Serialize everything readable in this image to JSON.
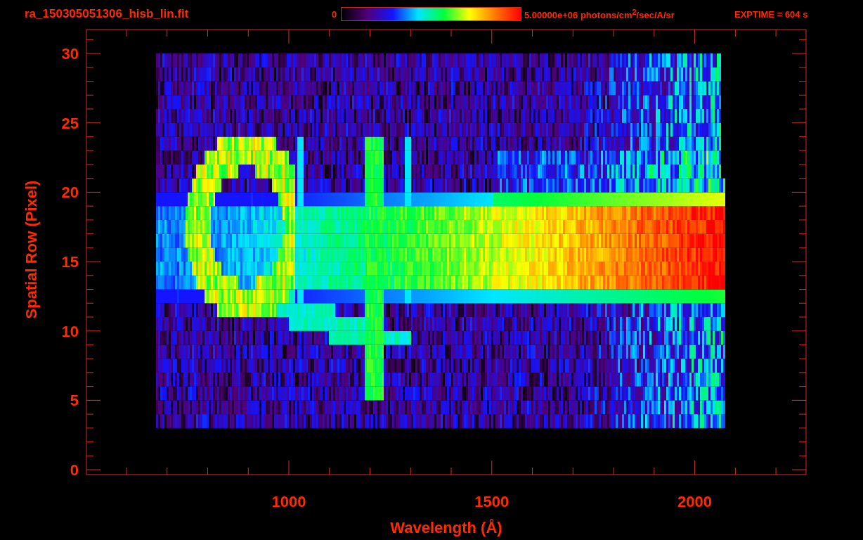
{
  "title": "ra_150305051306_hisb_lin.fit",
  "colorbar": {
    "min_label": "0",
    "max_label": "5.00000e+06 photons/cm$^{2}$/sec/A/sr"
  },
  "exposure": "EXPTIME = 604 s",
  "plot": {
    "ylabel": "Spatial Row (Pixel)",
    "xlabel": "Wavelength (Å)",
    "yticks": [
      "30",
      "25",
      "20",
      "15",
      "10",
      "5",
      "0"
    ],
    "xticks": [
      "1000",
      "1500",
      "2000"
    ]
  }
}
